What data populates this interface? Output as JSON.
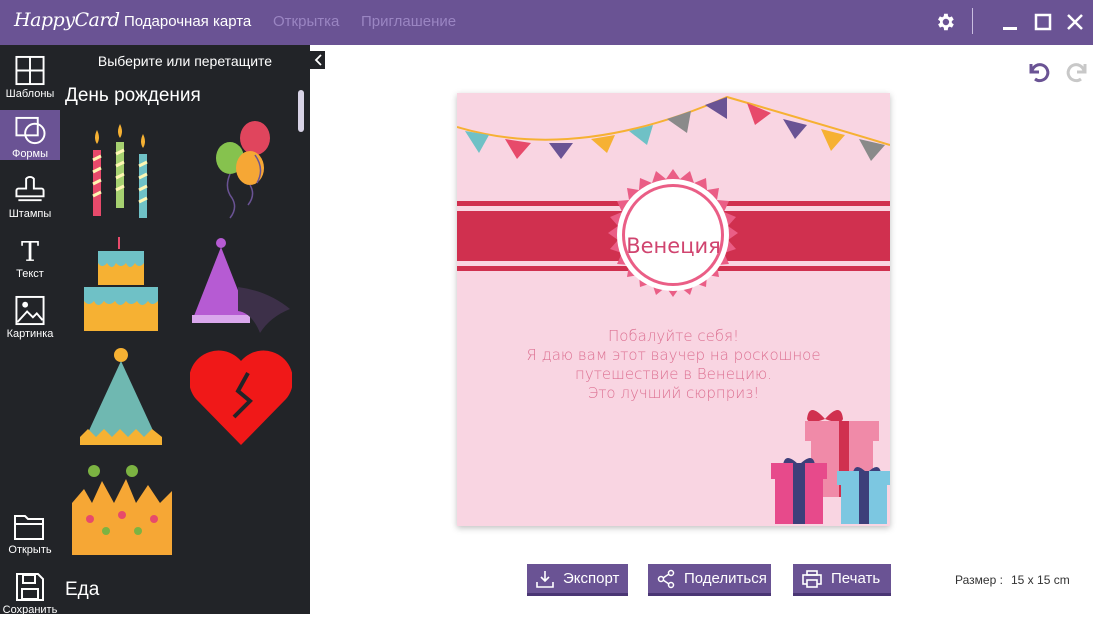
{
  "app": {
    "logo": "HappyCard"
  },
  "nav": {
    "tabs": [
      {
        "label": "Подарочная карта",
        "active": true
      },
      {
        "label": "Открытка",
        "active": false
      },
      {
        "label": "Приглашение",
        "active": false
      }
    ]
  },
  "window_controls": {
    "settings": "gear-icon",
    "minimize": "minimize-icon",
    "maximize": "maximize-icon",
    "close": "close-icon"
  },
  "rail": {
    "items": [
      {
        "label": "Шаблоны",
        "icon": "grid-icon"
      },
      {
        "label": "Формы",
        "icon": "shapes-icon",
        "active": true
      },
      {
        "label": "Штампы",
        "icon": "stamp-icon"
      },
      {
        "label": "Текст",
        "icon": "text-icon"
      },
      {
        "label": "Картинка",
        "icon": "image-icon"
      }
    ],
    "bottom": [
      {
        "label": "Открыть",
        "icon": "folder-icon"
      },
      {
        "label": "Сохранить",
        "icon": "save-icon"
      }
    ]
  },
  "panel": {
    "heading": "Выберите или перетащите",
    "categories": [
      "День рождения",
      "Еда"
    ]
  },
  "card": {
    "title": "Венеция",
    "lines": [
      "Побалуйте себя!",
      "Я даю вам этот ваучер на роскошное",
      "путешествие в Венецию.",
      "Это лучший сюрприз!"
    ]
  },
  "actions": {
    "export": "Экспорт",
    "share": "Поделиться",
    "print": "Печать"
  },
  "size": {
    "label": "Размер :",
    "value": "15 x 15 cm"
  },
  "colors": {
    "accent": "#6a5394",
    "panel": "#222428",
    "card": "#f9d5e2",
    "ribbon": "#d0304f"
  }
}
